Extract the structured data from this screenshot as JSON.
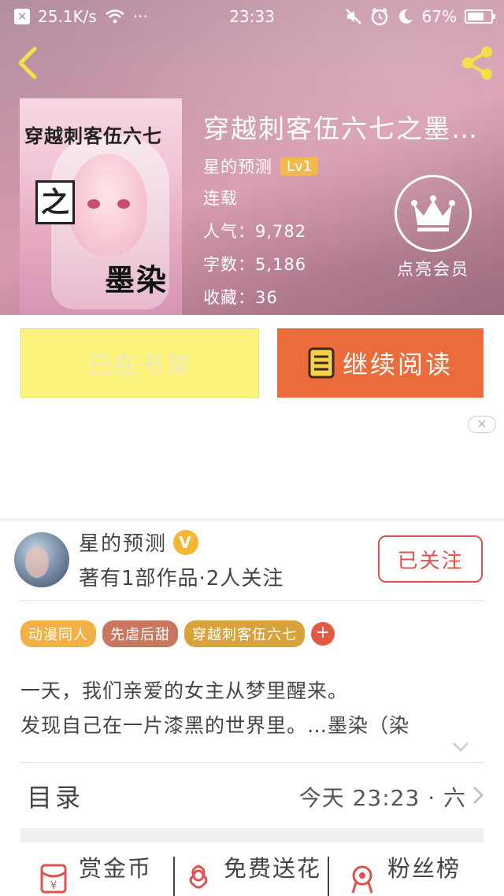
{
  "status_bar": {
    "speed": "25.1K/s",
    "dots": "···",
    "time": "23:33",
    "battery": "67%"
  },
  "book": {
    "cover_title": "穿越刺客伍六七",
    "cover_zhi": "之",
    "cover_mo": "墨染",
    "title": "穿越刺客伍六七之墨…",
    "author": "星的预测",
    "level": "Lv1",
    "status": "连载",
    "popularity_label": "人气：",
    "popularity": "9,782",
    "words_label": "字数：",
    "words": "5,186",
    "favorites_label": "收藏：",
    "favorites": "36",
    "vip_label": "点亮会员"
  },
  "actions": {
    "shelf_label": "已在书架",
    "read_label": "继续阅读"
  },
  "ad": {
    "close_label": "✕"
  },
  "author_card": {
    "name": "星的预测",
    "v_badge": "V",
    "stats": "著有1部作品·2人关注",
    "follow_label": "已关注"
  },
  "tags": [
    {
      "label": "动漫同人",
      "color": "#f3b045"
    },
    {
      "label": "先虐后甜",
      "color": "#c9785f"
    },
    {
      "label": "穿越刺客伍六七",
      "color": "#d7a33a"
    }
  ],
  "tag_add": "+",
  "intro": {
    "line1": "一天，我们亲爱的女主从梦里醒来。",
    "line2": "发现自己在一片漆黑的世界里。…墨染（染"
  },
  "toc": {
    "title": "目录",
    "update": "今天 23:23 · 六"
  },
  "bottom_bar": {
    "reward": "赏金币",
    "flowers": "免费送花",
    "fans": "粉丝榜"
  },
  "colors": {
    "accent_orange": "#ec6b3a",
    "shelf_yellow": "#fbf37c",
    "follow_red": "#e0524b",
    "level_gold": "#f2b94e"
  }
}
